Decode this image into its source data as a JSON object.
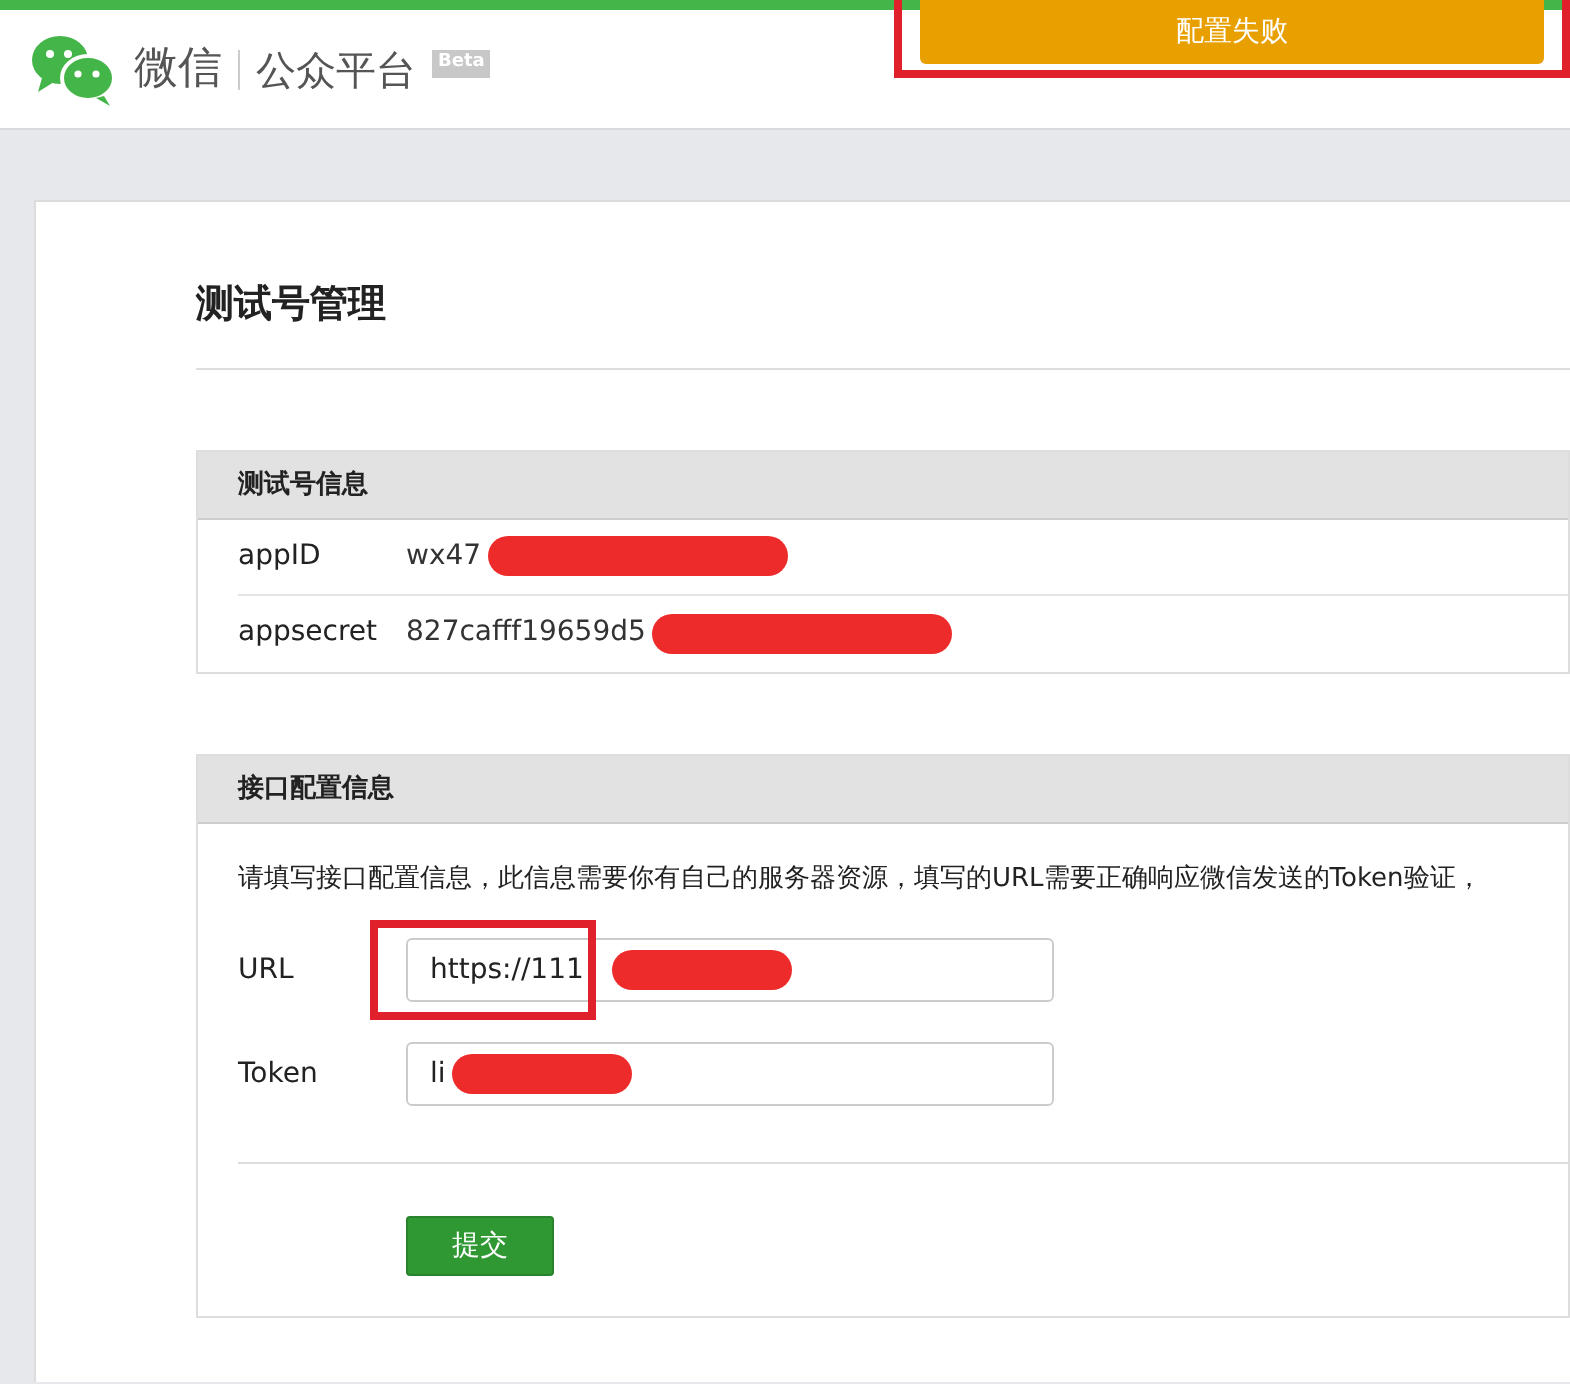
{
  "header": {
    "brand": "微信",
    "product": "公众平台",
    "badge": "Beta"
  },
  "toast": {
    "text": "配置失败"
  },
  "page_title": "测试号管理",
  "info_panel": {
    "title": "测试号信息",
    "rows": [
      {
        "label": "appID",
        "value": "wx47"
      },
      {
        "label": "appsecret",
        "value": "827cafff19659d5"
      }
    ]
  },
  "config_panel": {
    "title": "接口配置信息",
    "description": "请填写接口配置信息，此信息需要你有自己的服务器资源，填写的URL需要正确响应微信发送的Token验证，",
    "fields": [
      {
        "label": "URL",
        "value": "https://111",
        "highlighted": true
      },
      {
        "label": "Token",
        "value": "li",
        "highlighted": false
      }
    ],
    "submit": "提交"
  }
}
